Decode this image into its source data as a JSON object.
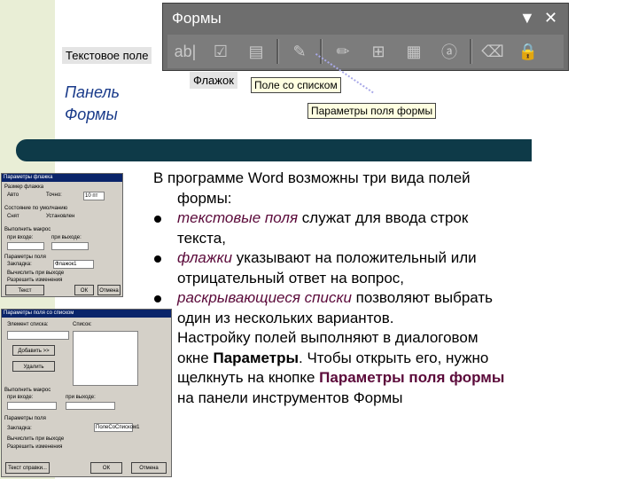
{
  "toolbar": {
    "title": "Формы",
    "dropdown_glyph": "▼",
    "close_glyph": "✕",
    "buttons": [
      {
        "icon": "text-field-icon",
        "glyph": "ab|"
      },
      {
        "icon": "checkbox-icon",
        "glyph": "☑"
      },
      {
        "icon": "combo-box-icon",
        "glyph": "▤"
      },
      {
        "icon": "field-options-icon",
        "glyph": "✎"
      },
      {
        "icon": "draw-table-icon",
        "glyph": "✏"
      },
      {
        "icon": "insert-table-icon",
        "glyph": "⊞"
      },
      {
        "icon": "insert-frame-icon",
        "glyph": "▦"
      },
      {
        "icon": "field-shading-icon",
        "glyph": "ⓐ"
      },
      {
        "icon": "reset-fields-icon",
        "glyph": "⌫"
      },
      {
        "icon": "protect-form-icon",
        "glyph": "🔒"
      }
    ]
  },
  "tooltips": {
    "text_field": "Текстовое поле",
    "checkbox": "Флажок",
    "combo_box": "Поле со списком",
    "field_options": "Параметры поля формы"
  },
  "side_title": {
    "line1": "Панель",
    "line2": "Формы"
  },
  "content": {
    "intro_1": "В программе Word возможны три вида полей",
    "intro_2": "формы:",
    "items": [
      {
        "em": "текстовые поля",
        "rest": " служат для ввода строк",
        "cont": "текста,"
      },
      {
        "em": "флажки",
        "rest": " указывают на положительный или",
        "cont": "отрицательный ответ на вопрос,"
      },
      {
        "em": "раскрывающиеся списки",
        "rest": " позволяют выбрать",
        "cont": "один из нескольких вариантов."
      }
    ],
    "outro_1": "Настройку полей выполняют в диалоговом",
    "outro_2a": "окне ",
    "outro_2b": "Параметры",
    "outro_2c": ". Чтобы открыть его, нужно",
    "outro_3a": "щелкнуть на кнопке ",
    "outro_3b": "Параметры поля формы",
    "outro_4": "на панели инструментов Формы"
  },
  "dialog_checkbox": {
    "title": "Параметры флажка",
    "size_label": "Размер флажка",
    "auto": "Авто",
    "exact": "Точно:",
    "size_value": "10 пт",
    "default_label": "Состояние по умолчанию",
    "unchecked": "Снят",
    "checked": "Установлен",
    "macro_label": "Выполнить макрос",
    "on_enter": "при входе:",
    "on_exit": "при выходе:",
    "field_props": "Параметры поля",
    "bookmark_label": "Закладка:",
    "bookmark_value": "Флажок1",
    "calc_on_exit": "Вычислить при выходе",
    "enabled": "Разрешить изменения",
    "help_button": "Текст справки...",
    "ok": "ОК",
    "cancel": "Отмена"
  },
  "dialog_dropdown": {
    "title": "Параметры поля со списком",
    "item_label": "Элемент списка:",
    "list_label": "Список:",
    "add_button": "Добавить >>",
    "remove_button": "Удалить",
    "macro_label": "Выполнить макрос",
    "on_enter": "при входе:",
    "on_exit": "при выходе:",
    "field_props": "Параметры поля",
    "bookmark_label": "Закладка:",
    "bookmark_value": "ПолеСоСписком1",
    "calc_on_exit": "Вычислить при выходе",
    "enabled": "Разрешить изменения",
    "help_button": "Текст справки...",
    "ok": "ОК",
    "cancel": "Отмена"
  }
}
